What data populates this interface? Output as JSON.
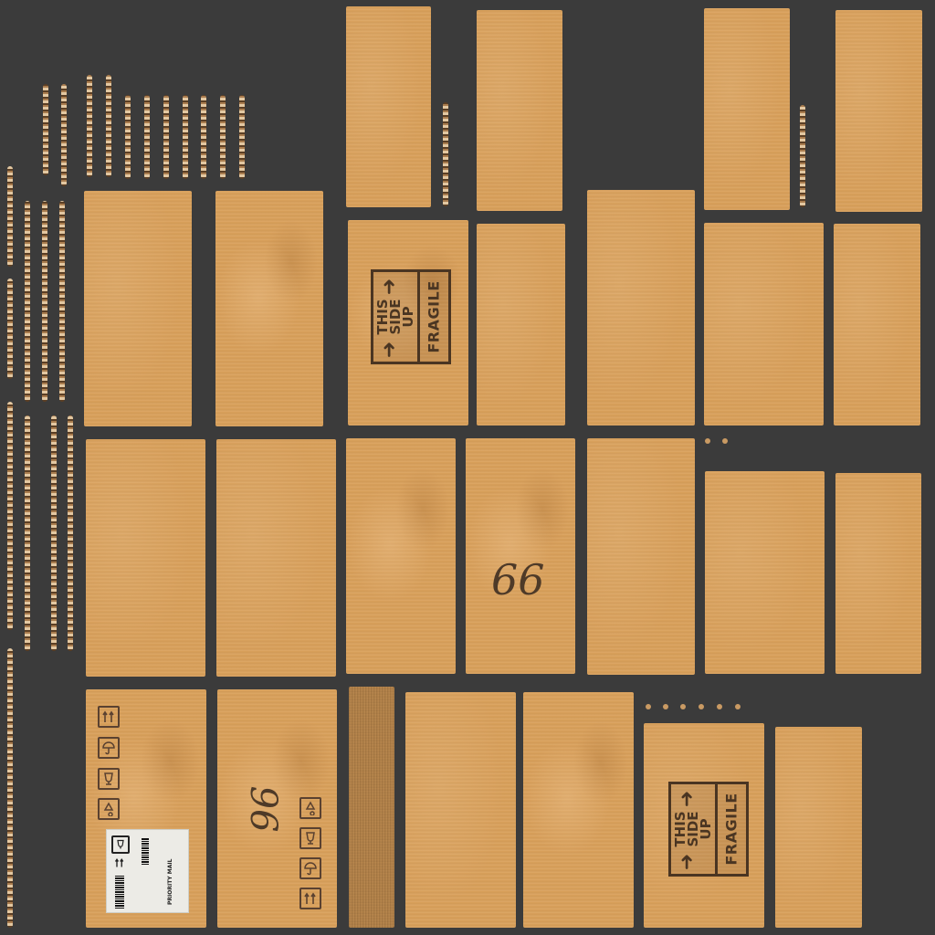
{
  "fragile_tag": {
    "line1": "THIS",
    "line2": "SIDE",
    "line3": "UP",
    "warning": "FRAGILE",
    "ink_color": "#4a3522",
    "arrow_icon": "up-arrow-icon"
  },
  "marker_text": {
    "panel_a": "66",
    "panel_b": "96"
  },
  "shipping_label": {
    "service": "PRIORITY MAIL"
  },
  "colors": {
    "background": "#3b3b3b",
    "cardboard": "#d9a05b",
    "tape": "#b8854a"
  }
}
